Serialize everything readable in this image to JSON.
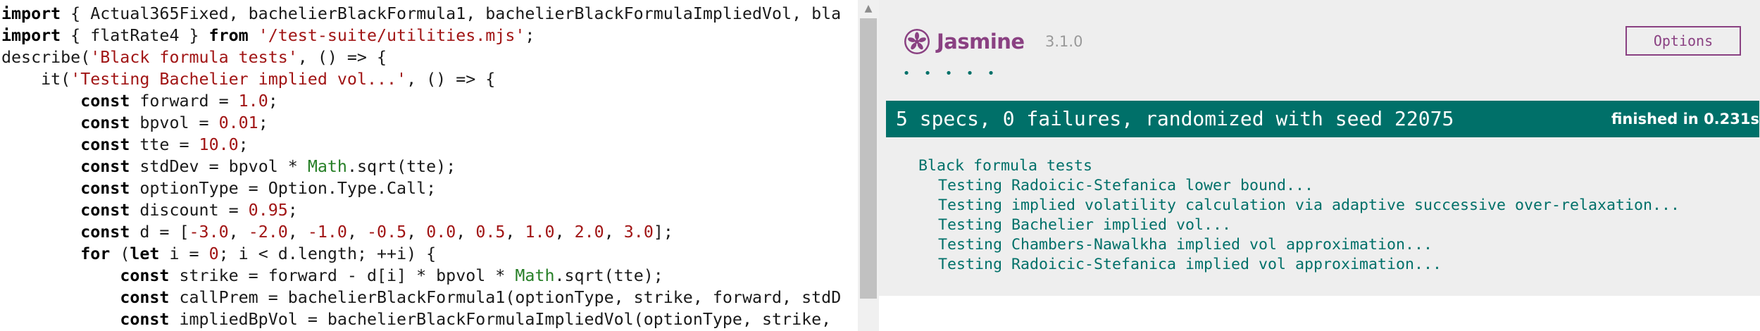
{
  "editor": {
    "lines": [
      [
        {
          "t": "import",
          "c": "kw"
        },
        {
          "t": " { Actual365Fixed, bachelierBlackFormula1, bachelierBlackFormulaImpliedVol, bla",
          "c": "plain"
        }
      ],
      [
        {
          "t": "import",
          "c": "kw"
        },
        {
          "t": " { flatRate4 } ",
          "c": "plain"
        },
        {
          "t": "from",
          "c": "kw"
        },
        {
          "t": " ",
          "c": "plain"
        },
        {
          "t": "'/test-suite/utilities.mjs'",
          "c": "str"
        },
        {
          "t": ";",
          "c": "plain"
        }
      ],
      [
        {
          "t": "describe(",
          "c": "plain"
        },
        {
          "t": "'Black formula tests'",
          "c": "str"
        },
        {
          "t": ", () => {",
          "c": "plain"
        }
      ],
      [
        {
          "t": "    it(",
          "c": "plain"
        },
        {
          "t": "'Testing Bachelier implied vol...'",
          "c": "str"
        },
        {
          "t": ", () => {",
          "c": "plain"
        }
      ],
      [
        {
          "t": "        ",
          "c": "plain"
        },
        {
          "t": "const",
          "c": "kw"
        },
        {
          "t": " forward = ",
          "c": "plain"
        },
        {
          "t": "1.0",
          "c": "num"
        },
        {
          "t": ";",
          "c": "plain"
        }
      ],
      [
        {
          "t": "        ",
          "c": "plain"
        },
        {
          "t": "const",
          "c": "kw"
        },
        {
          "t": " bpvol = ",
          "c": "plain"
        },
        {
          "t": "0.01",
          "c": "num"
        },
        {
          "t": ";",
          "c": "plain"
        }
      ],
      [
        {
          "t": "        ",
          "c": "plain"
        },
        {
          "t": "const",
          "c": "kw"
        },
        {
          "t": " tte = ",
          "c": "plain"
        },
        {
          "t": "10.0",
          "c": "num"
        },
        {
          "t": ";",
          "c": "plain"
        }
      ],
      [
        {
          "t": "        ",
          "c": "plain"
        },
        {
          "t": "const",
          "c": "kw"
        },
        {
          "t": " stdDev = bpvol * ",
          "c": "plain"
        },
        {
          "t": "Math",
          "c": "builtin"
        },
        {
          "t": ".sqrt(tte);",
          "c": "plain"
        }
      ],
      [
        {
          "t": "        ",
          "c": "plain"
        },
        {
          "t": "const",
          "c": "kw"
        },
        {
          "t": " optionType = Option.Type.Call;",
          "c": "plain"
        }
      ],
      [
        {
          "t": "        ",
          "c": "plain"
        },
        {
          "t": "const",
          "c": "kw"
        },
        {
          "t": " discount = ",
          "c": "plain"
        },
        {
          "t": "0.95",
          "c": "num"
        },
        {
          "t": ";",
          "c": "plain"
        }
      ],
      [
        {
          "t": "        ",
          "c": "plain"
        },
        {
          "t": "const",
          "c": "kw"
        },
        {
          "t": " d = [",
          "c": "plain"
        },
        {
          "t": "-3.0",
          "c": "num"
        },
        {
          "t": ", ",
          "c": "plain"
        },
        {
          "t": "-2.0",
          "c": "num"
        },
        {
          "t": ", ",
          "c": "plain"
        },
        {
          "t": "-1.0",
          "c": "num"
        },
        {
          "t": ", ",
          "c": "plain"
        },
        {
          "t": "-0.5",
          "c": "num"
        },
        {
          "t": ", ",
          "c": "plain"
        },
        {
          "t": "0.0",
          "c": "num"
        },
        {
          "t": ", ",
          "c": "plain"
        },
        {
          "t": "0.5",
          "c": "num"
        },
        {
          "t": ", ",
          "c": "plain"
        },
        {
          "t": "1.0",
          "c": "num"
        },
        {
          "t": ", ",
          "c": "plain"
        },
        {
          "t": "2.0",
          "c": "num"
        },
        {
          "t": ", ",
          "c": "plain"
        },
        {
          "t": "3.0",
          "c": "num"
        },
        {
          "t": "];",
          "c": "plain"
        }
      ],
      [
        {
          "t": "        ",
          "c": "plain"
        },
        {
          "t": "for",
          "c": "kw"
        },
        {
          "t": " (",
          "c": "plain"
        },
        {
          "t": "let",
          "c": "kw"
        },
        {
          "t": " i = ",
          "c": "plain"
        },
        {
          "t": "0",
          "c": "num"
        },
        {
          "t": "; i < d.length; ++i) {",
          "c": "plain"
        }
      ],
      [
        {
          "t": "            ",
          "c": "plain"
        },
        {
          "t": "const",
          "c": "kw"
        },
        {
          "t": " strike = forward - d[i] * bpvol * ",
          "c": "plain"
        },
        {
          "t": "Math",
          "c": "builtin"
        },
        {
          "t": ".sqrt(tte);",
          "c": "plain"
        }
      ],
      [
        {
          "t": "            ",
          "c": "plain"
        },
        {
          "t": "const",
          "c": "kw"
        },
        {
          "t": " callPrem = bachelierBlackFormula1(optionType, strike, forward, stdD",
          "c": "plain"
        }
      ],
      [
        {
          "t": "            ",
          "c": "plain"
        },
        {
          "t": "const",
          "c": "kw"
        },
        {
          "t": " impliedBpVol = bachelierBlackFormulaImpliedVol(optionType, strike,",
          "c": "plain"
        }
      ]
    ],
    "scroll_up_glyph": "▲",
    "colors": {
      "keyword": "#000000",
      "string": "#a11515",
      "number": "#a11515",
      "builtin": "#267f26",
      "text": "#1a1a1a"
    }
  },
  "reporter": {
    "logo_text": "Jasmine",
    "logo_icon": "jasmine-flower-icon",
    "version": "3.1.0",
    "options_label": "Options",
    "dots": [
      "•",
      "•",
      "•",
      "•",
      "•"
    ],
    "summary": "5 specs, 0 failures, randomized with seed 22075",
    "duration": "finished in 0.231s",
    "suite": {
      "title": "Black formula tests",
      "specs": [
        "Testing Radoicic-Stefanica lower bound...",
        "Testing implied volatility calculation via adaptive successive over-relaxation...",
        "Testing Bachelier implied vol...",
        "Testing Chambers-Nawalkha implied vol approximation...",
        "Testing Radoicic-Stefanica implied vol approximation..."
      ]
    },
    "colors": {
      "brand": "#8a4182",
      "passed": "#007069",
      "background": "#eeeeee",
      "version": "#999999"
    }
  }
}
